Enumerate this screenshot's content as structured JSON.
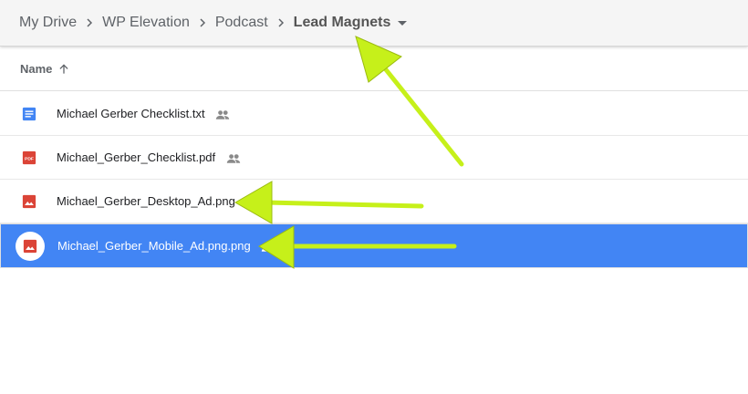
{
  "breadcrumb": {
    "items": [
      "My Drive",
      "WP Elevation",
      "Podcast"
    ],
    "current": "Lead Magnets"
  },
  "columns": {
    "name_label": "Name",
    "sort": "ascending"
  },
  "files": [
    {
      "name": "Michael Gerber Checklist.txt",
      "type": "doc",
      "shared": true,
      "selected": false
    },
    {
      "name": "Michael_Gerber_Checklist.pdf",
      "type": "pdf",
      "shared": true,
      "selected": false
    },
    {
      "name": "Michael_Gerber_Desktop_Ad.png",
      "type": "image",
      "shared": true,
      "selected": false
    },
    {
      "name": "Michael_Gerber_Mobile_Ad.png.png",
      "type": "image",
      "shared": true,
      "selected": true
    }
  ],
  "icons": {
    "doc": "document-icon",
    "pdf": "pdf-icon",
    "image": "image-icon",
    "shared": "shared-people-icon"
  },
  "colors": {
    "selected_row": "#4285f4",
    "doc_icon": "#4285f4",
    "pdf_icon": "#db4437",
    "image_icon": "#db4437",
    "annotation_arrow": "#c6f01a"
  },
  "pdf_icon_text": "PDF"
}
